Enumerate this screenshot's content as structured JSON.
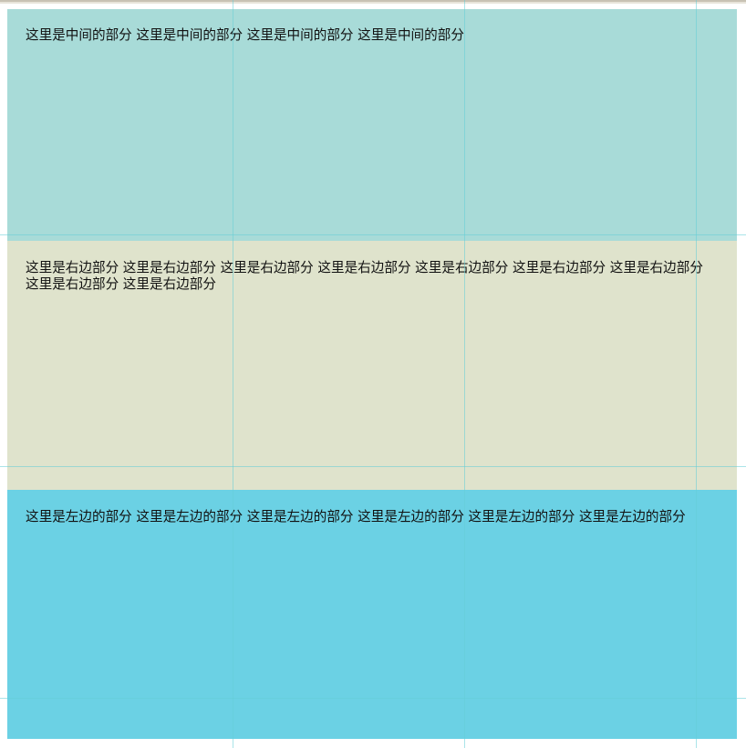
{
  "colors": {
    "middle_bg": "#a8dbd8",
    "right_bg": "#dfe3cc",
    "left_bg": "#6bd1e4",
    "guide_line": "#64cdd7"
  },
  "sections": {
    "middle": {
      "text": "这里是中间的部分  这里是中间的部分  这里是中间的部分  这里是中间的部分"
    },
    "right": {
      "text": "这里是右边部分  这里是右边部分  这里是右边部分  这里是右边部分  这里是右边部分  这里是右边部分  这里是右边部分  这里是右边部分  这里是右边部分"
    },
    "left": {
      "text": "这里是左边的部分  这里是左边的部分  这里是左边的部分  这里是左边的部分  这里是左边的部分  这里是左边的部分"
    }
  }
}
